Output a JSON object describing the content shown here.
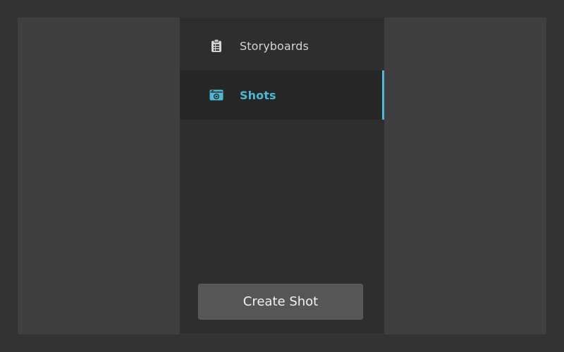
{
  "sidebar": {
    "items": [
      {
        "label": "Storyboards",
        "icon": "clipboard-list-icon",
        "active": false
      },
      {
        "label": "Shots",
        "icon": "camera-icon",
        "active": true
      }
    ],
    "create_button_label": "Create Shot"
  },
  "colors": {
    "background": "#333333",
    "panel": "#3f3f3f",
    "sidebar": "#2e2e2e",
    "active_item_bg": "#262626",
    "accent": "#4bb8d4",
    "button": "#565656",
    "text": "#d4d4d4"
  }
}
